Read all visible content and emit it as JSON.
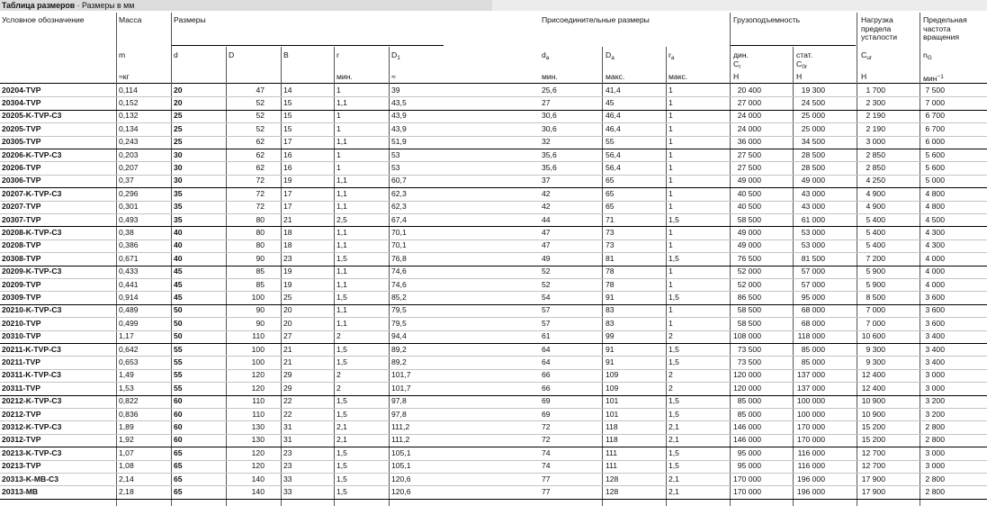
{
  "title": {
    "main": "Таблица размеров",
    "sep": " · ",
    "sub": "Размеры в мм"
  },
  "headers": {
    "designation": "Условное обозначение",
    "mass": "Масса",
    "mass_sym": "m",
    "mass_unit": "≈кг",
    "dimensions": "Размеры",
    "d": "d",
    "D": "D",
    "B": "B",
    "r": "r",
    "r_min": "мин.",
    "D1": "D",
    "D1_sub": "1",
    "D1_approx": "≈",
    "mounting": "Присоединительные размеры",
    "da": "d",
    "da_sub": "a",
    "da_min": "мин.",
    "Da": "D",
    "Da_sub": "a",
    "Da_max": "макс.",
    "ra": "r",
    "ra_sub": "a",
    "ra_max": "макс.",
    "load": "Грузоподъемность",
    "dyn": "дин.",
    "Cr": "C",
    "Cr_sub": "r",
    "Cr_unit": "Н",
    "stat": "стат.",
    "Cor": "C",
    "Cor_sub": "0r",
    "Cor_unit": "Н",
    "fatigue_l1": "Нагрузка",
    "fatigue_l2": "предела",
    "fatigue_l3": "усталости",
    "Cur": "C",
    "Cur_sub": "ur",
    "Cur_unit": "Н",
    "speed_l1": "Предельная",
    "speed_l2": "частота",
    "speed_l3": "вращения",
    "nG": "n",
    "nG_sub": "G",
    "nG_unit": "мин",
    "nG_sup": "−1"
  },
  "rows": [
    [
      "20204-TVP",
      "0,114",
      "20",
      "47",
      "14",
      "1",
      "39",
      "25,6",
      "41,4",
      "1",
      "20 400",
      "19 300",
      "1 700",
      "7 500"
    ],
    [
      "20304-TVP",
      "0,152",
      "20",
      "52",
      "15",
      "1,1",
      "43,5",
      "27",
      "45",
      "1",
      "27 000",
      "24 500",
      "2 300",
      "7 000"
    ],
    [
      "20205-K-TVP-C3",
      "0,132",
      "25",
      "52",
      "15",
      "1",
      "43,9",
      "30,6",
      "46,4",
      "1",
      "24 000",
      "25 000",
      "2 190",
      "6 700"
    ],
    [
      "20205-TVP",
      "0,134",
      "25",
      "52",
      "15",
      "1",
      "43,9",
      "30,6",
      "46,4",
      "1",
      "24 000",
      "25 000",
      "2 190",
      "6 700"
    ],
    [
      "20305-TVP",
      "0,243",
      "25",
      "62",
      "17",
      "1,1",
      "51,9",
      "32",
      "55",
      "1",
      "36 000",
      "34 500",
      "3 000",
      "6 000"
    ],
    [
      "20206-K-TVP-C3",
      "0,203",
      "30",
      "62",
      "16",
      "1",
      "53",
      "35,6",
      "56,4",
      "1",
      "27 500",
      "28 500",
      "2 850",
      "5 600"
    ],
    [
      "20206-TVP",
      "0,207",
      "30",
      "62",
      "16",
      "1",
      "53",
      "35,6",
      "56,4",
      "1",
      "27 500",
      "28 500",
      "2 850",
      "5 600"
    ],
    [
      "20306-TVP",
      "0,37",
      "30",
      "72",
      "19",
      "1,1",
      "60,7",
      "37",
      "65",
      "1",
      "49 000",
      "49 000",
      "4 250",
      "5 000"
    ],
    [
      "20207-K-TVP-C3",
      "0,296",
      "35",
      "72",
      "17",
      "1,1",
      "62,3",
      "42",
      "65",
      "1",
      "40 500",
      "43 000",
      "4 900",
      "4 800"
    ],
    [
      "20207-TVP",
      "0,301",
      "35",
      "72",
      "17",
      "1,1",
      "62,3",
      "42",
      "65",
      "1",
      "40 500",
      "43 000",
      "4 900",
      "4 800"
    ],
    [
      "20307-TVP",
      "0,493",
      "35",
      "80",
      "21",
      "2,5",
      "67,4",
      "44",
      "71",
      "1,5",
      "58 500",
      "61 000",
      "5 400",
      "4 500"
    ],
    [
      "20208-K-TVP-C3",
      "0,38",
      "40",
      "80",
      "18",
      "1,1",
      "70,1",
      "47",
      "73",
      "1",
      "49 000",
      "53 000",
      "5 400",
      "4 300"
    ],
    [
      "20208-TVP",
      "0,386",
      "40",
      "80",
      "18",
      "1,1",
      "70,1",
      "47",
      "73",
      "1",
      "49 000",
      "53 000",
      "5 400",
      "4 300"
    ],
    [
      "20308-TVP",
      "0,671",
      "40",
      "90",
      "23",
      "1,5",
      "76,8",
      "49",
      "81",
      "1,5",
      "76 500",
      "81 500",
      "7 200",
      "4 000"
    ],
    [
      "20209-K-TVP-C3",
      "0,433",
      "45",
      "85",
      "19",
      "1,1",
      "74,6",
      "52",
      "78",
      "1",
      "52 000",
      "57 000",
      "5 900",
      "4 000"
    ],
    [
      "20209-TVP",
      "0,441",
      "45",
      "85",
      "19",
      "1,1",
      "74,6",
      "52",
      "78",
      "1",
      "52 000",
      "57 000",
      "5 900",
      "4 000"
    ],
    [
      "20309-TVP",
      "0,914",
      "45",
      "100",
      "25",
      "1,5",
      "85,2",
      "54",
      "91",
      "1,5",
      "86 500",
      "95 000",
      "8 500",
      "3 600"
    ],
    [
      "20210-K-TVP-C3",
      "0,489",
      "50",
      "90",
      "20",
      "1,1",
      "79,5",
      "57",
      "83",
      "1",
      "58 500",
      "68 000",
      "7 000",
      "3 600"
    ],
    [
      "20210-TVP",
      "0,499",
      "50",
      "90",
      "20",
      "1,1",
      "79,5",
      "57",
      "83",
      "1",
      "58 500",
      "68 000",
      "7 000",
      "3 600"
    ],
    [
      "20310-TVP",
      "1,17",
      "50",
      "110",
      "27",
      "2",
      "94,4",
      "61",
      "99",
      "2",
      "108 000",
      "118 000",
      "10 600",
      "3 400"
    ],
    [
      "20211-K-TVP-C3",
      "0,642",
      "55",
      "100",
      "21",
      "1,5",
      "89,2",
      "64",
      "91",
      "1,5",
      "73 500",
      "85 000",
      "9 300",
      "3 400"
    ],
    [
      "20211-TVP",
      "0,653",
      "55",
      "100",
      "21",
      "1,5",
      "89,2",
      "64",
      "91",
      "1,5",
      "73 500",
      "85 000",
      "9 300",
      "3 400"
    ],
    [
      "20311-K-TVP-C3",
      "1,49",
      "55",
      "120",
      "29",
      "2",
      "101,7",
      "66",
      "109",
      "2",
      "120 000",
      "137 000",
      "12 400",
      "3 000"
    ],
    [
      "20311-TVP",
      "1,53",
      "55",
      "120",
      "29",
      "2",
      "101,7",
      "66",
      "109",
      "2",
      "120 000",
      "137 000",
      "12 400",
      "3 000"
    ],
    [
      "20212-K-TVP-C3",
      "0,822",
      "60",
      "110",
      "22",
      "1,5",
      "97,8",
      "69",
      "101",
      "1,5",
      "85 000",
      "100 000",
      "10 900",
      "3 200"
    ],
    [
      "20212-TVP",
      "0,836",
      "60",
      "110",
      "22",
      "1,5",
      "97,8",
      "69",
      "101",
      "1,5",
      "85 000",
      "100 000",
      "10 900",
      "3 200"
    ],
    [
      "20312-K-TVP-C3",
      "1,89",
      "60",
      "130",
      "31",
      "2,1",
      "111,2",
      "72",
      "118",
      "2,1",
      "146 000",
      "170 000",
      "15 200",
      "2 800"
    ],
    [
      "20312-TVP",
      "1,92",
      "60",
      "130",
      "31",
      "2,1",
      "111,2",
      "72",
      "118",
      "2,1",
      "146 000",
      "170 000",
      "15 200",
      "2 800"
    ],
    [
      "20213-K-TVP-C3",
      "1,07",
      "65",
      "120",
      "23",
      "1,5",
      "105,1",
      "74",
      "111",
      "1,5",
      "95 000",
      "116 000",
      "12 700",
      "3 000"
    ],
    [
      "20213-TVP",
      "1,08",
      "65",
      "120",
      "23",
      "1,5",
      "105,1",
      "74",
      "111",
      "1,5",
      "95 000",
      "116 000",
      "12 700",
      "3 000"
    ],
    [
      "20313-K-MB-C3",
      "2,14",
      "65",
      "140",
      "33",
      "1,5",
      "120,6",
      "77",
      "128",
      "2,1",
      "170 000",
      "196 000",
      "17 900",
      "2 800"
    ],
    [
      "20313-MB",
      "2,18",
      "65",
      "140",
      "33",
      "1,5",
      "120,6",
      "77",
      "128",
      "2,1",
      "170 000",
      "196 000",
      "17 900",
      "2 800"
    ]
  ]
}
